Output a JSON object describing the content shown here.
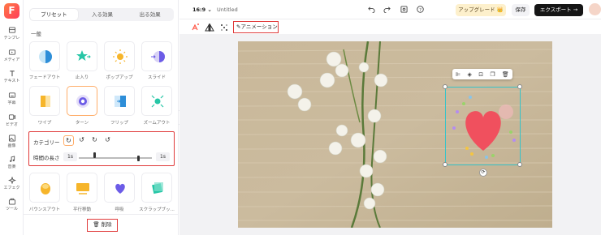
{
  "app": {
    "logo_letter": "F",
    "brand_color": "#ff5a4a"
  },
  "rail": {
    "items": [
      {
        "label": "テンプレ",
        "icon": "template-icon"
      },
      {
        "label": "メディア",
        "icon": "media-icon"
      },
      {
        "label": "テキスト",
        "icon": "text-icon"
      },
      {
        "label": "字幕",
        "icon": "subtitle-icon"
      },
      {
        "label": "ビデオ",
        "icon": "video-icon"
      },
      {
        "label": "画像",
        "icon": "image-icon"
      },
      {
        "label": "音楽",
        "icon": "music-icon"
      },
      {
        "label": "エフェク",
        "icon": "effect-icon"
      },
      {
        "label": "ツール",
        "icon": "tools-icon"
      }
    ]
  },
  "panel": {
    "tabs": [
      {
        "label": "プリセット",
        "active": true
      },
      {
        "label": "入る効果",
        "active": false
      },
      {
        "label": "出る効果",
        "active": false
      }
    ],
    "section_title": "一般",
    "presets": [
      {
        "label": "フェードアウト",
        "icon": "fade-icon"
      },
      {
        "label": "止入り",
        "icon": "star-icon"
      },
      {
        "label": "ポップアップ",
        "icon": "popup-icon"
      },
      {
        "label": "スライド",
        "icon": "slide-icon"
      },
      {
        "label": "ワイプ",
        "icon": "wipe-icon"
      },
      {
        "label": "ターン",
        "icon": "turn-icon",
        "selected": true
      },
      {
        "label": "フリップ",
        "icon": "flip-icon"
      },
      {
        "label": "ズームアウト",
        "icon": "zoom-out-icon"
      },
      {
        "label": "バウンスアウト",
        "icon": "bounce-icon"
      },
      {
        "label": "平行移動",
        "icon": "translate-icon"
      },
      {
        "label": "呼吸",
        "icon": "breath-icon"
      },
      {
        "label": "スクラップブッ...",
        "icon": "scrapbook-icon"
      }
    ],
    "settings": {
      "category_label": "カテゴリー",
      "direction_icons": [
        "↻",
        "↺",
        "↻",
        "↺"
      ],
      "duration_label": "時間の長さ",
      "start_value": "1s",
      "end_value": "1s"
    },
    "delete_label": "削除"
  },
  "topbar": {
    "ratio": "16:9",
    "doc_title": "Untitled",
    "upgrade_label": "アップグレード 👑",
    "save_label": "保存",
    "export_label": "エクスポート →"
  },
  "toolbar": {
    "animation_label": "アニメーション"
  },
  "colors": {
    "accent_orange": "#ffae6b",
    "highlight_red": "#e03a3a",
    "selection_teal": "#36c3c9",
    "heart": "#f0505e"
  }
}
